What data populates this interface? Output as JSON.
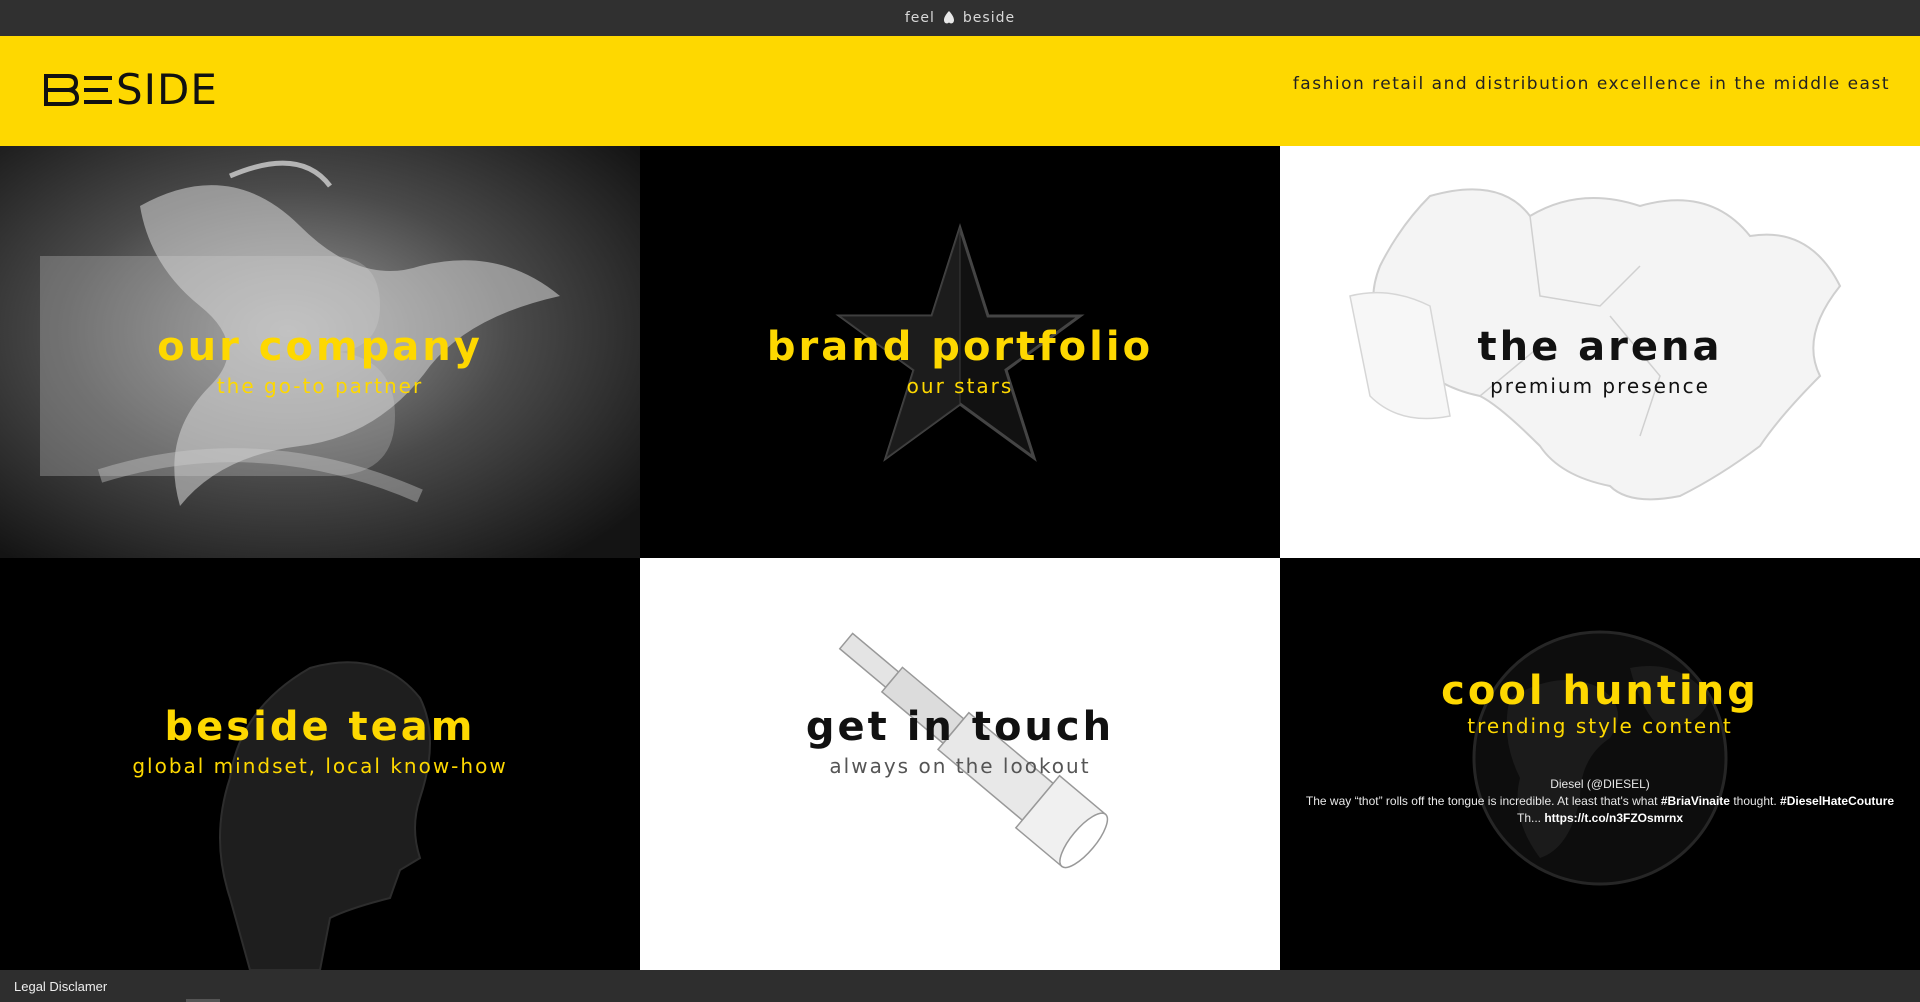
{
  "topbar": {
    "tagline_left": "feel",
    "tagline_right": "beside"
  },
  "header": {
    "logo_text": "SIDE",
    "slogan": "Fashion retail and distribution excellence in the middle east"
  },
  "tiles": [
    {
      "title": "our company",
      "subtitle": "the go-to partner"
    },
    {
      "title": "brand portfolio",
      "subtitle": "our stars"
    },
    {
      "title": "the arena",
      "subtitle": "premium presence"
    },
    {
      "title": "beside team",
      "subtitle": "global mindset, local know-how"
    },
    {
      "title": "get in touch",
      "subtitle": "always on the lookout"
    },
    {
      "title": "cool hunting",
      "subtitle": "trending style content"
    }
  ],
  "tweet": {
    "author": "Diesel (@DIESEL)",
    "text_1": "The way “thot” rolls off the tongue is incredible. At least that's what ",
    "tag_1": "#BriaVinaite",
    "text_2": " thought. ",
    "tag_2": "#DieselHateCouture",
    "text_3": "Th... ",
    "link": "https://t.co/n3FZOsmrnx"
  },
  "footer": {
    "legal": "Legal Disclamer"
  },
  "colors": {
    "accent": "#fed800",
    "dark_bg": "#000000",
    "bar_bg": "#303030"
  },
  "icons": [
    "heart-icon",
    "beside-logo-mark",
    "star-icon",
    "map-icon",
    "head-icon",
    "telescope-icon",
    "globe-icon"
  ]
}
